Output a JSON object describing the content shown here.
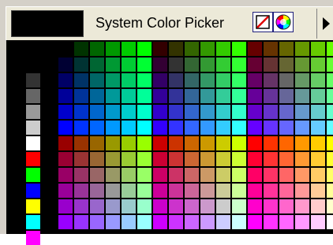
{
  "picker": {
    "title": "System Color Picker",
    "current_color": "#000000",
    "tools": [
      {
        "name": "no-color-icon"
      },
      {
        "name": "color-wheel-icon"
      },
      {
        "name": "next-arrow-icon"
      }
    ]
  },
  "system_swatches": [
    "#000000",
    "#333333",
    "#666666",
    "#999999",
    "#cccccc",
    "#ffffff",
    "#ff0000",
    "#00ff00",
    "#0000ff",
    "#ffff00",
    "#00ffff",
    "#ff00ff"
  ]
}
